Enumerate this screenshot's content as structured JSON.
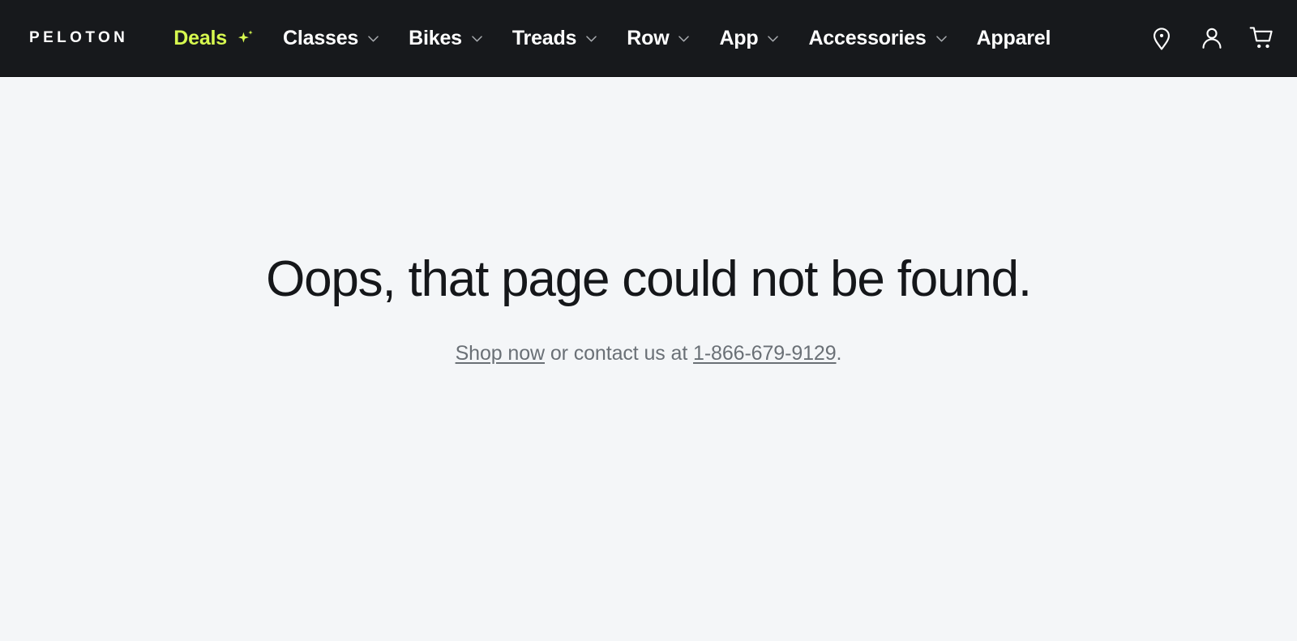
{
  "theme": {
    "nav_background": "#17191c",
    "page_background": "#f4f6f8",
    "accent_lime": "#d7f94f",
    "headline_color": "#15171a",
    "muted_text": "#6a7076"
  },
  "navbar": {
    "logo": "PELOTON",
    "items": [
      {
        "label": "Deals",
        "has_chevron": false,
        "has_sparkle": true,
        "accent": true,
        "icon": "sparkle-icon"
      },
      {
        "label": "Classes",
        "has_chevron": true,
        "has_sparkle": false,
        "accent": false,
        "icon": "chevron-down-icon"
      },
      {
        "label": "Bikes",
        "has_chevron": true,
        "has_sparkle": false,
        "accent": false,
        "icon": "chevron-down-icon"
      },
      {
        "label": "Treads",
        "has_chevron": true,
        "has_sparkle": false,
        "accent": false,
        "icon": "chevron-down-icon"
      },
      {
        "label": "Row",
        "has_chevron": true,
        "has_sparkle": false,
        "accent": false,
        "icon": "chevron-down-icon"
      },
      {
        "label": "App",
        "has_chevron": true,
        "has_sparkle": false,
        "accent": false,
        "icon": "chevron-down-icon"
      },
      {
        "label": "Accessories",
        "has_chevron": true,
        "has_sparkle": false,
        "accent": false,
        "icon": "chevron-down-icon"
      },
      {
        "label": "Apparel",
        "has_chevron": false,
        "has_sparkle": false,
        "accent": false,
        "icon": ""
      }
    ],
    "icons": [
      {
        "name": "location-pin-icon"
      },
      {
        "name": "account-person-icon"
      },
      {
        "name": "shopping-cart-icon"
      }
    ]
  },
  "main": {
    "headline": "Oops, that page could not be found.",
    "subline": {
      "shop_link": "Shop now",
      "middle_text": " or contact us at ",
      "phone_link": "1-866-679-9129",
      "trailing": "."
    }
  }
}
